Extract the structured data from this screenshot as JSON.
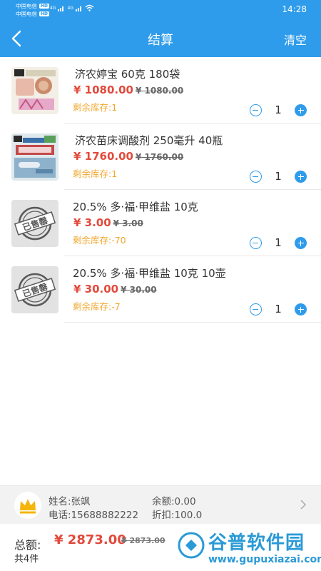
{
  "status_bar": {
    "carrier_1": "中国电信",
    "carrier_2": "中国电信",
    "hd_badge": "HD",
    "network_1": "4G",
    "network_2": "4G",
    "time": "14:28"
  },
  "header": {
    "title": "结算",
    "clear_label": "清空"
  },
  "cart_items": [
    {
      "name": "济农婷宝 60克  180袋",
      "price": "¥ 1080.00",
      "original_price": "¥ 1080.00",
      "stock": "剩余库存:1",
      "quantity": "1",
      "image": "product-photo-icon"
    },
    {
      "name": "济农苗床调酸剂 250毫升  40瓶",
      "price": "¥ 1760.00",
      "original_price": "¥ 1760.00",
      "stock": "剩余库存:1",
      "quantity": "1",
      "image": "product-photo-icon"
    },
    {
      "name": "20.5% 多·福·甲维盐 10克",
      "price": "¥ 3.00",
      "original_price": "¥ 3.00",
      "stock": "剩余库存:-70",
      "quantity": "1",
      "image": "sold-out-stamp-icon",
      "stamp_text": "已售罄"
    },
    {
      "name": "20.5% 多·福·甲维盐 10克  10壶",
      "price": "¥ 30.00",
      "original_price": "¥ 30.00",
      "stock": "剩余库存:-7",
      "quantity": "1",
      "image": "sold-out-stamp-icon",
      "stamp_text": "已售罄"
    }
  ],
  "member": {
    "name": "姓名:张飒",
    "phone": "电话:15688882222",
    "balance": "余额:0.00",
    "discount": "折扣:100.0",
    "icon": "crown-icon"
  },
  "summary": {
    "total_label": "总额:",
    "total": "¥ 2873.00",
    "original_total": "¥ 2873.00",
    "count": "共4件"
  },
  "watermark": {
    "title": "谷普软件园",
    "url": "www.gupuxiazai.com"
  },
  "colors": {
    "primary": "#2f9ceb",
    "price": "#e24a3c",
    "stock": "#f0a830"
  }
}
